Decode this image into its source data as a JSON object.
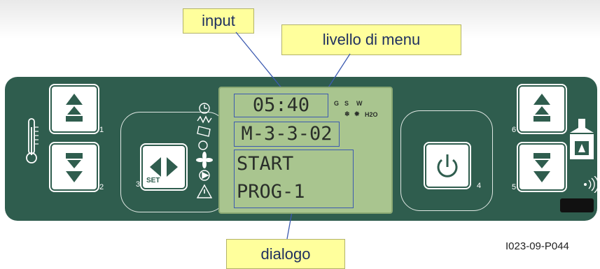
{
  "labels": {
    "input": "input",
    "livello": "livello di menu",
    "dialogo": "dialogo"
  },
  "display": {
    "time": "05:40",
    "menu_level": "M-3-3-02",
    "dialog_line1": "START",
    "dialog_line2": "PROG-1",
    "status_g": "G",
    "status_s": "S",
    "status_w": "W",
    "status_h2o": "H2O"
  },
  "buttons": {
    "b1": "1",
    "b2": "2",
    "b3": "3",
    "set": "SET",
    "b4": "4",
    "b5": "5",
    "b6": "6"
  },
  "figure_code": "I023-09-P044",
  "colors": {
    "panel": "#2f5d4e",
    "lcd": "#a9c58f",
    "callout": "#ffff9c",
    "leader_line": "#3c5ab0"
  },
  "icons": {
    "left": "thermometer-icon",
    "right": "fireplace-icon",
    "signal": "signal-waves-icon"
  }
}
